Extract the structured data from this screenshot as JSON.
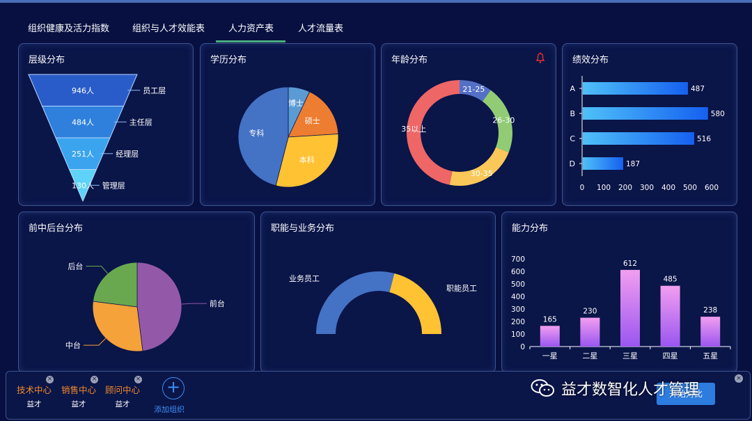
{
  "tabs": [
    {
      "label": "组织健康及活力指数"
    },
    {
      "label": "组织与人才效能表"
    },
    {
      "label": "人力资产表",
      "active": true
    },
    {
      "label": "人才流量表"
    }
  ],
  "colors": {
    "accent": "#4ab07f",
    "background": "#071040",
    "panel_border": "#3f5590",
    "highlight": "#f08a2a",
    "button": "#2d7de0"
  },
  "panels": {
    "level": {
      "title": "层级分布"
    },
    "education": {
      "title": "学历分布"
    },
    "age": {
      "title": "年龄分布",
      "bell_icon": "bell-icon"
    },
    "performance": {
      "title": "绩效分布"
    },
    "office": {
      "title": "前中后台分布"
    },
    "function": {
      "title": "职能与业务分布"
    },
    "ability": {
      "title": "能力分布"
    }
  },
  "chart_data": [
    {
      "type": "funnel",
      "title": "层级分布",
      "categories": [
        "员工层",
        "主任层",
        "经理层",
        "管理层"
      ],
      "data_labels": [
        "946人",
        "484人",
        "251人",
        "130人"
      ],
      "values": [
        946,
        484,
        251,
        130
      ],
      "colors": [
        "#2a5cc9",
        "#2f80dd",
        "#3ba4ee",
        "#5fd3f7"
      ]
    },
    {
      "type": "pie",
      "title": "学历分布",
      "categories": [
        "博士",
        "硕士",
        "本科",
        "专科"
      ],
      "values": [
        7,
        17,
        30,
        46
      ],
      "colors": [
        "#5b9bd5",
        "#ed7d31",
        "#ffc233",
        "#4472c4"
      ]
    },
    {
      "type": "pie",
      "title": "年龄分布",
      "donut": true,
      "categories": [
        "21-25",
        "26-30",
        "30-35",
        "35以上"
      ],
      "values": [
        10,
        21,
        22,
        47
      ],
      "colors": [
        "#5470c6",
        "#91cc75",
        "#fac858",
        "#ee6666"
      ]
    },
    {
      "type": "bar",
      "title": "绩效分布",
      "orientation": "horizontal",
      "categories": [
        "A",
        "B",
        "C",
        "D"
      ],
      "values": [
        487,
        580,
        516,
        187
      ],
      "xticks": [
        "0",
        "100",
        "200",
        "300",
        "400",
        "500",
        "600"
      ],
      "xlim": [
        0,
        600
      ]
    },
    {
      "type": "pie",
      "title": "前中后台分布",
      "categories": [
        "前台",
        "中台",
        "后台"
      ],
      "values": [
        48,
        29,
        23
      ],
      "colors": [
        "#9458a8",
        "#f5a23a",
        "#6aa84f"
      ]
    },
    {
      "type": "pie",
      "title": "职能与业务分布",
      "half_donut": true,
      "categories": [
        "业务员工",
        "职能员工"
      ],
      "values": [
        58,
        42
      ],
      "colors": [
        "#4472c4",
        "#ffc233"
      ]
    },
    {
      "type": "bar",
      "title": "能力分布",
      "categories": [
        "一星",
        "二星",
        "三星",
        "四星",
        "五星"
      ],
      "values": [
        165,
        230,
        612,
        485,
        238
      ],
      "yticks": [
        "0",
        "100",
        "200",
        "300",
        "400",
        "500",
        "600",
        "700"
      ],
      "ylim": [
        0,
        700
      ]
    }
  ],
  "bottom": {
    "orgs": [
      {
        "name": "技术中心",
        "sub": "益才"
      },
      {
        "name": "销售中心",
        "sub": "益才"
      },
      {
        "name": "顾问中心",
        "sub": "益才"
      }
    ],
    "add_label": "添加组织",
    "compare_label": "开始对比",
    "close_glyph": "×",
    "add_glyph": "+"
  },
  "watermark": {
    "text": "益才数智化人才管理",
    "icon": "wechat-icon"
  }
}
